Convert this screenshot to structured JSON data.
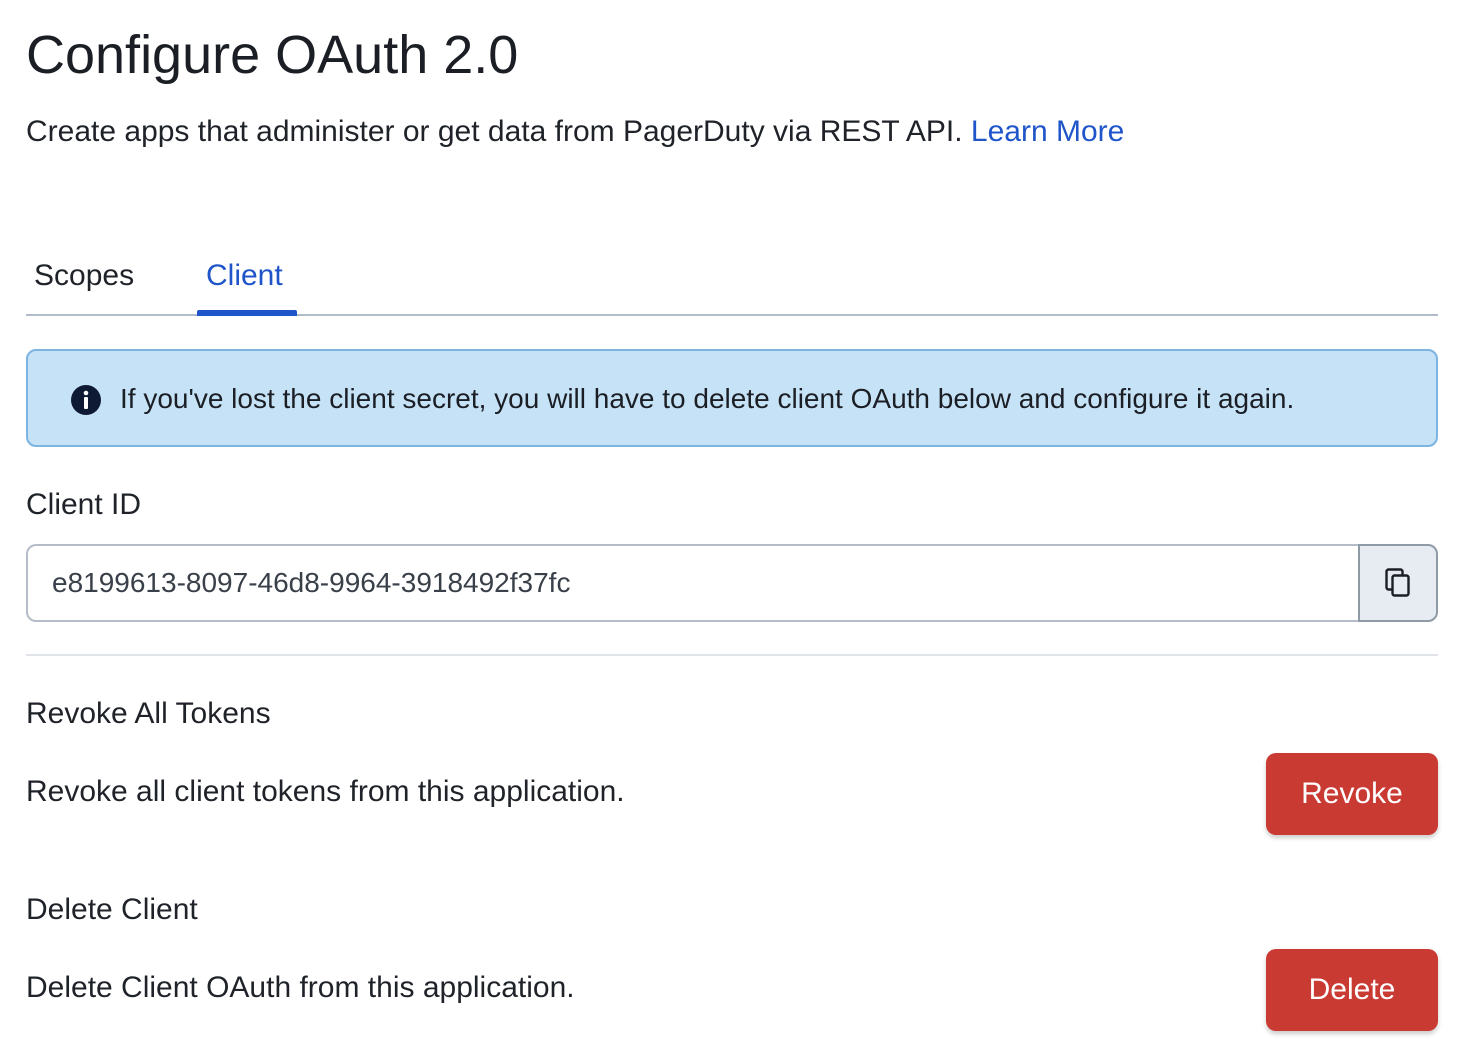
{
  "page": {
    "title": "Configure OAuth 2.0",
    "subtitle": "Create apps that administer or get data from PagerDuty via REST API.",
    "learn_more": "Learn More"
  },
  "tabs": [
    {
      "label": "Scopes",
      "active": false
    },
    {
      "label": "Client",
      "active": true
    }
  ],
  "alert": {
    "icon": "info-icon",
    "text": "If you've lost the client secret, you will have to delete client OAuth below and configure it again."
  },
  "client_id": {
    "label": "Client ID",
    "value": "e8199613-8097-46d8-9964-3918492f37fc",
    "copy_icon": "copy-icon"
  },
  "revoke": {
    "heading": "Revoke All Tokens",
    "description": "Revoke all client tokens from this application.",
    "button_label": "Revoke"
  },
  "delete": {
    "heading": "Delete Client",
    "description": "Delete Client OAuth from this application.",
    "button_label": "Delete"
  },
  "colors": {
    "link": "#1f55c8",
    "alert_bg": "#c6e2f6",
    "alert_border": "#7cb4e2",
    "danger": "#c93a33"
  }
}
